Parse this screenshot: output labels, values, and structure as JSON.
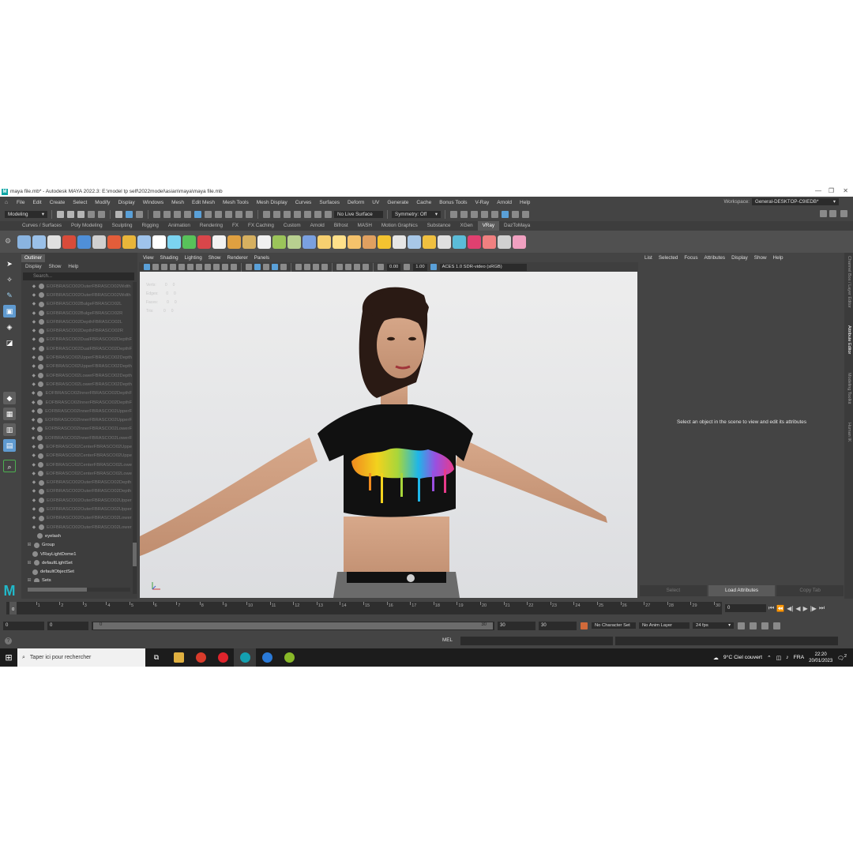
{
  "window": {
    "title": "maya file.mb* - Autodesk MAYA 2022.3: E:\\model tp self\\2022model\\asian\\maya\\maya file.mb",
    "app_icon": "M",
    "controls": [
      "—",
      "❐",
      "✕"
    ]
  },
  "menubar": {
    "items": [
      "File",
      "Edit",
      "Create",
      "Select",
      "Modify",
      "Display",
      "Windows",
      "Mesh",
      "Edit Mesh",
      "Mesh Tools",
      "Mesh Display",
      "Curves",
      "Surfaces",
      "Deform",
      "UV",
      "Generate",
      "Cache",
      "Bonus Tools",
      "V-Ray",
      "Arnold",
      "Help"
    ],
    "workspace_label": "Workspace:",
    "workspace_value": "General-DESKTOP-C9IEDB*"
  },
  "statusline": {
    "mode": "Modeling",
    "live_surface": "No Live Surface",
    "symmetry": "Symmetry: Off"
  },
  "shelf": {
    "tabs": [
      "Curves / Surfaces",
      "Poly Modeling",
      "Sculpting",
      "Rigging",
      "Animation",
      "Rendering",
      "FX",
      "FX Caching",
      "Custom",
      "Arnold",
      "Bifrost",
      "MASH",
      "Motion Graphics",
      "Substance",
      "XGen",
      "VRay",
      "DazToMaya"
    ],
    "active_tab": "VRay",
    "icon_colors": [
      "#8ab4e0",
      "#9ac0e8",
      "#e0e0e0",
      "#d84b3a",
      "#4f8fd8",
      "#d0d0d0",
      "#e35d3a",
      "#e8b53a",
      "#9fc4ec",
      "#ffffff",
      "#7bd3f0",
      "#58c25a",
      "#d9464a",
      "#f2f2f2",
      "#e0a040",
      "#d6b060",
      "#f0f0f0",
      "#9bc45a",
      "#b8d090",
      "#7aa0e0",
      "#f7d070",
      "#ffe08a",
      "#f5c26b",
      "#e0a060",
      "#f4c430",
      "#e6e6e6",
      "#a8c8e8",
      "#f0c040",
      "#e0e0e0",
      "#5bbcd8",
      "#e04070",
      "#f08080",
      "#d0d0d0",
      "#f0a0c0"
    ]
  },
  "outliner": {
    "tab": "Outliner",
    "menu": [
      "Display",
      "Show",
      "Help"
    ],
    "search_placeholder": "Search...",
    "items": [
      {
        "label": "EOFBRASCO02OuterFBRASCO02Width",
        "dim": true
      },
      {
        "label": "EOFBRASCO02OuterFBRASCO02Width",
        "dim": true
      },
      {
        "label": "EOFBRASCO02BulgeFBRASCO02L",
        "dim": true
      },
      {
        "label": "EOFBRASCO02BulgeFBRASCO02R",
        "dim": true
      },
      {
        "label": "EOFBRASCO02DepthFBRASCO02L",
        "dim": true
      },
      {
        "label": "EOFBRASCO02DepthFBRASCO02R",
        "dim": true
      },
      {
        "label": "EOFBRASCO02DualFBRASCO02DepthF",
        "dim": true
      },
      {
        "label": "EOFBRASCO02DualFBRASCO02DepthF",
        "dim": true
      },
      {
        "label": "EOFBRASCO02UpperFBRASCO02Depth",
        "dim": true
      },
      {
        "label": "EOFBRASCO02UpperFBRASCO02Depth",
        "dim": true
      },
      {
        "label": "EOFBRASCO02LowerFBRASCO02Depth",
        "dim": true
      },
      {
        "label": "EOFBRASCO02LowerFBRASCO02Depth",
        "dim": true
      },
      {
        "label": "EOFBRASCO02InnerFBRASCO02DepthF",
        "dim": true
      },
      {
        "label": "EOFBRASCO02InnerFBRASCO02DepthF",
        "dim": true
      },
      {
        "label": "EOFBRASCO02InnerFBRASCO02UpperF",
        "dim": true
      },
      {
        "label": "EOFBRASCO02InnerFBRASCO02UpperF",
        "dim": true
      },
      {
        "label": "EOFBRASCO02InnerFBRASCO02LowerF",
        "dim": true
      },
      {
        "label": "EOFBRASCO02InnerFBRASCO02LowerF",
        "dim": true
      },
      {
        "label": "EOFBRASCO02CenterFBRASCO02Uppe",
        "dim": true
      },
      {
        "label": "EOFBRASCO02CenterFBRASCO02Uppe",
        "dim": true
      },
      {
        "label": "EOFBRASCO02CenterFBRASCO02Lowe",
        "dim": true
      },
      {
        "label": "EOFBRASCO02CenterFBRASCO02Lowe",
        "dim": true
      },
      {
        "label": "EOFBRASCO02OuterFBRASCO02Depth",
        "dim": true
      },
      {
        "label": "EOFBRASCO02OuterFBRASCO02Depth",
        "dim": true
      },
      {
        "label": "EOFBRASCO02OuterFBRASCO02Upper",
        "dim": true
      },
      {
        "label": "EOFBRASCO02OuterFBRASCO02Upper",
        "dim": true
      },
      {
        "label": "EOFBRASCO02OuterFBRASCO02Lower",
        "dim": true
      },
      {
        "label": "EOFBRASCO02OuterFBRASCO02Lower",
        "dim": true
      },
      {
        "label": "eyelash",
        "dim": false
      },
      {
        "label": "Group",
        "dim": false,
        "expandable": true
      },
      {
        "label": "VRayLightDome1",
        "dim": false
      },
      {
        "label": "defaultLightSet",
        "dim": false,
        "expandable": true
      },
      {
        "label": "defaultObjectSet",
        "dim": false
      },
      {
        "label": "Sets",
        "dim": false,
        "expandable": true
      }
    ]
  },
  "viewport": {
    "menu": [
      "View",
      "Shading",
      "Lighting",
      "Show",
      "Renderer",
      "Panels"
    ],
    "exposure": "0.00",
    "gamma": "1.00",
    "color_space": "ACES 1.0 SDR-video (sRGB)"
  },
  "attribute_editor": {
    "menu": [
      "List",
      "Selected",
      "Focus",
      "Attributes",
      "Display",
      "Show",
      "Help"
    ],
    "message": "Select an object in the scene to view and edit its attributes",
    "buttons": [
      "Select",
      "Load Attributes",
      "Copy Tab"
    ],
    "side_tabs": [
      "Channel Box / Layer Editor",
      "Attribute Editor",
      "Modeling Toolkit",
      "Human IK"
    ]
  },
  "timeline": {
    "ticks": [
      "0",
      "1",
      "2",
      "3",
      "4",
      "5",
      "6",
      "7",
      "8",
      "9",
      "10",
      "11",
      "12",
      "13",
      "14",
      "15",
      "16",
      "17",
      "18",
      "19",
      "20",
      "21",
      "22",
      "23",
      "24",
      "25",
      "26",
      "27",
      "28",
      "29",
      "30"
    ],
    "current_frame": "0",
    "current_field": "0"
  },
  "range": {
    "start": "0",
    "anim_start": "0",
    "slider_start": "0",
    "slider_end": "30",
    "anim_end": "30",
    "end": "30",
    "character_set": "No Character Set",
    "anim_layer": "No Anim Layer",
    "fps": "24 fps"
  },
  "cmdline": {
    "help": "?",
    "mel": "MEL"
  },
  "taskbar": {
    "search_placeholder": "Taper ici pour rechercher",
    "weather": "9°C  Ciel couvert",
    "lang": "FRA",
    "time": "22:20",
    "date": "20/01/2023",
    "notifications": "2",
    "app_colors": [
      "#e0b040",
      "#d93b2b",
      "#e0242c",
      "#14a0b0",
      "#2a7ad8",
      "#88b828"
    ]
  }
}
